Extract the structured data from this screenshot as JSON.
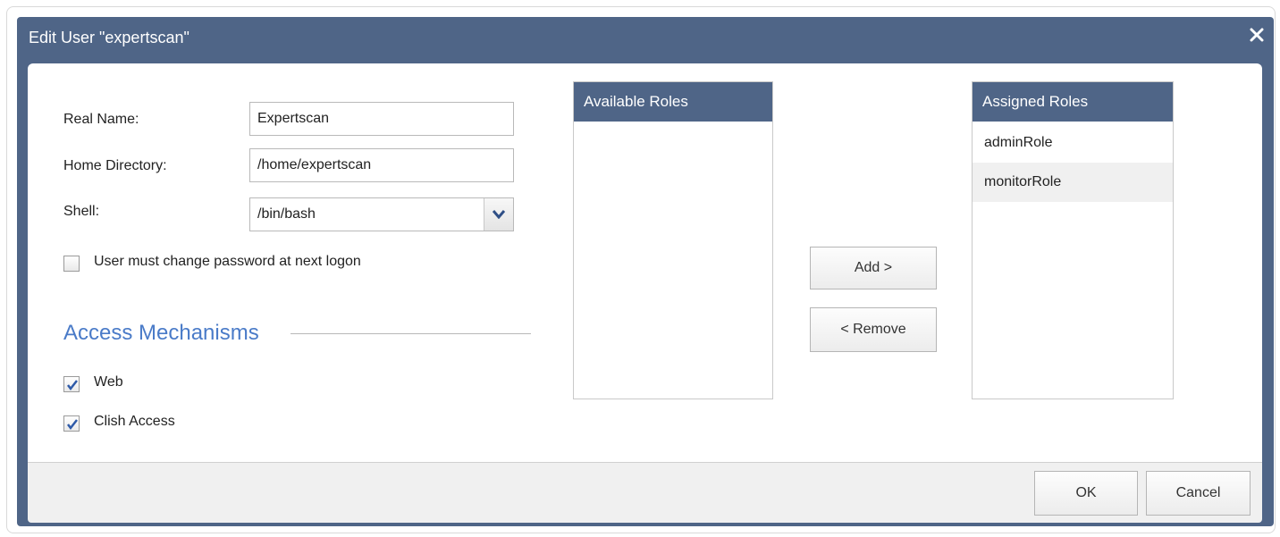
{
  "dialog": {
    "title": "Edit User \"expertscan\"",
    "close_glyph": "✕"
  },
  "form": {
    "real_name_label": "Real Name:",
    "real_name_value": "Expertscan",
    "home_directory_label": "Home Directory:",
    "home_directory_value": "/home/expertscan",
    "shell_label": "Shell:",
    "shell_value": "/bin/bash",
    "change_password_label": "User must change password at next logon",
    "change_password_checked": false
  },
  "access": {
    "title": "Access Mechanisms",
    "items": [
      {
        "label": "Web",
        "checked": true
      },
      {
        "label": "Clish Access",
        "checked": true
      }
    ]
  },
  "roles": {
    "available_title": "Available Roles",
    "available_items": [],
    "assigned_title": "Assigned Roles",
    "assigned_items": [
      "adminRole",
      "monitorRole"
    ],
    "add_label": "Add >",
    "remove_label": "< Remove"
  },
  "footer": {
    "ok_label": "OK",
    "cancel_label": "Cancel"
  },
  "colors": {
    "header": "#4f6587",
    "accent": "#4a7bc8"
  }
}
